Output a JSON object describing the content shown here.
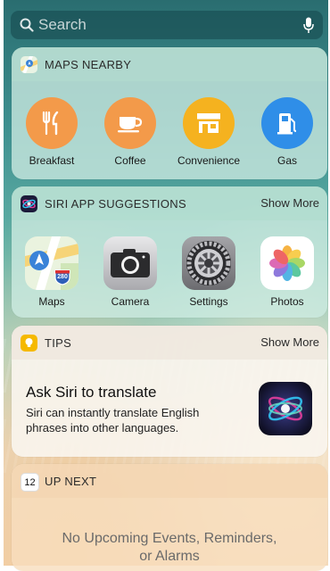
{
  "search": {
    "placeholder": "Search"
  },
  "maps_nearby": {
    "title": "MAPS NEARBY",
    "items": [
      {
        "label": "Breakfast",
        "icon": "fork-knife-icon",
        "color": "#f39a4a"
      },
      {
        "label": "Coffee",
        "icon": "coffee-cup-icon",
        "color": "#f39a4a"
      },
      {
        "label": "Convenience",
        "icon": "storefront-icon",
        "color": "#f5b21f"
      },
      {
        "label": "Gas",
        "icon": "gas-pump-icon",
        "color": "#2f8ee8"
      }
    ]
  },
  "siri_suggestions": {
    "title": "SIRI APP SUGGESTIONS",
    "show_more": "Show More",
    "apps": [
      {
        "label": "Maps",
        "icon": "maps-app-icon",
        "map_badge": "280"
      },
      {
        "label": "Camera",
        "icon": "camera-app-icon"
      },
      {
        "label": "Settings",
        "icon": "settings-app-icon"
      },
      {
        "label": "Photos",
        "icon": "photos-app-icon"
      }
    ]
  },
  "tips": {
    "title": "TIPS",
    "show_more": "Show More",
    "heading": "Ask Siri to translate",
    "body_line1": "Siri can instantly translate English",
    "body_line2": "phrases into other languages."
  },
  "up_next": {
    "title": "UP NEXT",
    "calendar_day": "12",
    "empty_line1": "No Upcoming Events, Reminders,",
    "empty_line2": "or Alarms"
  }
}
